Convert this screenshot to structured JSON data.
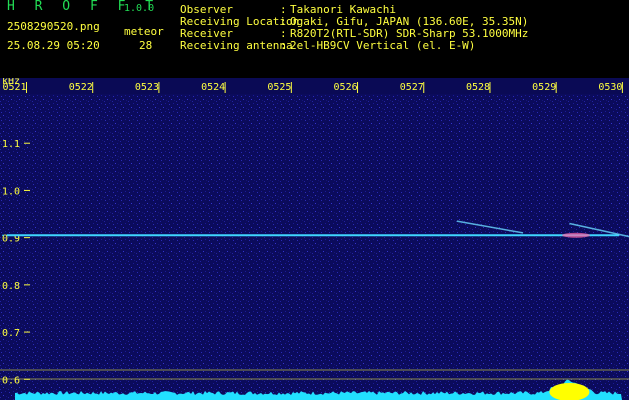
{
  "header": {
    "app_name": "H R O F F T",
    "app_version": "1.0.0",
    "filename": "2508290520.png",
    "datetime": "25.08.29 05:20",
    "meteor_label": "meteor",
    "meteor_count": "28",
    "info": [
      {
        "label": "Observer",
        "sep": ":",
        "value": "Takanori Kawachi"
      },
      {
        "label": "Receiving Location",
        "sep": ":",
        "value": "Ogaki, Gifu, JAPAN (136.60E, 35.35N)"
      },
      {
        "label": "Receiver",
        "sep": ":",
        "value": "R820T2(RTL-SDR) SDR-Sharp 53.1000MHz"
      },
      {
        "label": "Receiving antenna",
        "sep": ":",
        "value": "2el-HB9CV Vertical (el. E-W)"
      }
    ]
  },
  "colors": {
    "header_green": "#22dd55",
    "header_yellow": "#ffff40",
    "axis_yellow": "#ffff40",
    "background": "#0a0a55",
    "carrier_line": "#3fd6ff",
    "spectrum_fill": "#22e0ff",
    "spectrum_peak": "#ffff00"
  },
  "chart_data": {
    "type": "heatmap",
    "ylabel": "kHz",
    "y_ticks": [
      "1.1",
      "1.0",
      "0.9",
      "0.8",
      "0.7",
      "0.6"
    ],
    "y_values": [
      1.1,
      1.0,
      0.9,
      0.8,
      0.7,
      0.6
    ],
    "ylim": [
      0.59,
      1.2
    ],
    "x_ticks": [
      "0521",
      "0522",
      "0523",
      "0524",
      "0525",
      "0526",
      "0527",
      "0528",
      "0529",
      "0530"
    ],
    "x_range_minutes": [
      20.6,
      30.1
    ],
    "carrier_khz": 0.905,
    "carrier_start_minute": 20.7,
    "meteor_echoes": [
      {
        "minute": 27.5,
        "khz_start": 0.935,
        "khz_end": 0.91,
        "duration_min": 1.0
      },
      {
        "minute": 29.2,
        "khz_start": 0.93,
        "khz_end": 0.89,
        "duration_min": 1.3
      }
    ],
    "spectrum_activity_minute": 29.2
  }
}
